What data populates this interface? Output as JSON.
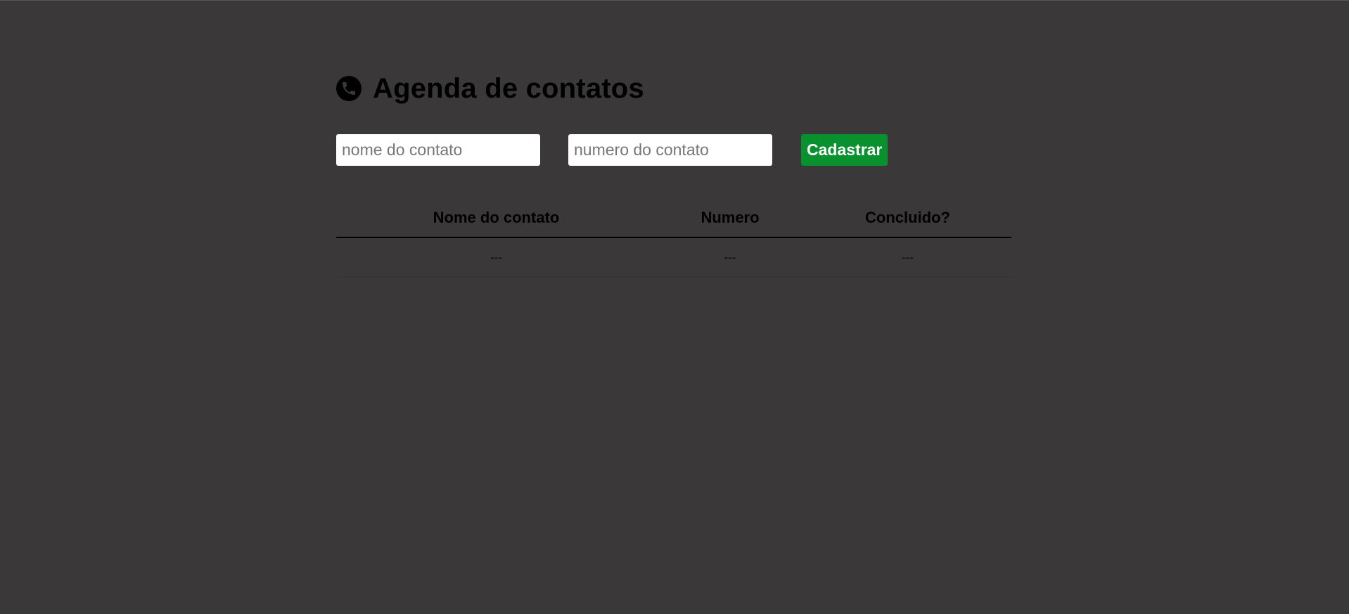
{
  "header": {
    "title": "Agenda de contatos",
    "icon": "phone-icon"
  },
  "form": {
    "name_placeholder": "nome do contato",
    "number_placeholder": "numero do contato",
    "submit_label": "Cadastrar"
  },
  "table": {
    "headers": [
      "Nome do contato",
      "Numero",
      "Concluido?"
    ],
    "rows": [
      [
        "---",
        "---",
        "---"
      ]
    ]
  },
  "colors": {
    "background": "#3a3839",
    "button": "#08912e",
    "input": "#ffffff",
    "text": "#000000"
  }
}
